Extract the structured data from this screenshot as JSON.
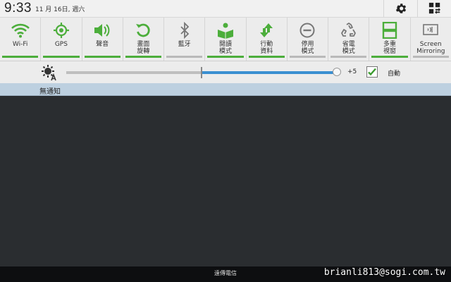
{
  "status_bar": {
    "time": "9:33",
    "date": "11 月 16日, 週六"
  },
  "quick_toggles": [
    {
      "label": "Wi-Fi",
      "icon": "wifi-icon",
      "active": true
    },
    {
      "label": "GPS",
      "icon": "gps-icon",
      "active": true
    },
    {
      "label": "聲音",
      "icon": "speaker-icon",
      "active": true
    },
    {
      "label": "畫面\n旋轉",
      "icon": "rotate-icon",
      "active": true
    },
    {
      "label": "藍牙",
      "icon": "bluetooth-icon",
      "active": false
    },
    {
      "label": "閱讀\n模式",
      "icon": "reading-icon",
      "active": true
    },
    {
      "label": "行動\n資料",
      "icon": "mobile-data-icon",
      "active": true
    },
    {
      "label": "停用\n模式",
      "icon": "block-icon",
      "active": false
    },
    {
      "label": "省電\n模式",
      "icon": "recycle-icon",
      "active": false
    },
    {
      "label": "多重\n視窗",
      "icon": "multi-window-icon",
      "active": true
    },
    {
      "label": "Screen\nMirroring",
      "icon": "screen-mirroring-icon",
      "active": false
    }
  ],
  "brightness": {
    "level": 1.0,
    "marker": 0.5,
    "value_label": "+5",
    "auto_checked": true,
    "auto_label": "自動"
  },
  "notifications": {
    "header": "無通知"
  },
  "bottom": {
    "carrier": "遠傳電信",
    "watermark": "brianli813@sogi.com.tw"
  },
  "colors": {
    "active_green": "#4cae3b",
    "inactive_gray": "#b9b9b9",
    "slider_blue": "#3a8fd1"
  }
}
